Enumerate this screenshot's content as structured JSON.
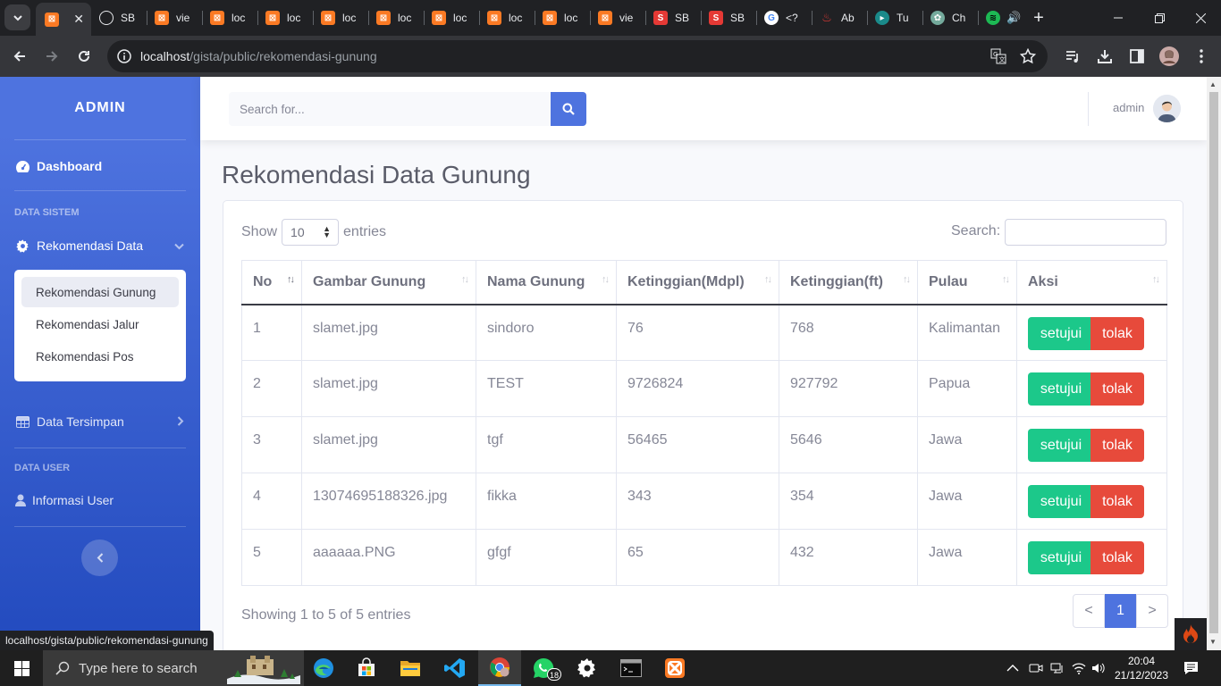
{
  "browser": {
    "tabs": [
      {
        "title": "",
        "icon": "xampp-icon",
        "color": "#fb7a24",
        "active": true
      },
      {
        "title": "SB",
        "icon": "globe-icon",
        "color": "#e8eaed"
      },
      {
        "title": "vie",
        "icon": "xampp-icon",
        "color": "#fb7a24"
      },
      {
        "title": "loc",
        "icon": "xampp-icon",
        "color": "#fb7a24"
      },
      {
        "title": "loc",
        "icon": "xampp-icon",
        "color": "#fb7a24"
      },
      {
        "title": "loc",
        "icon": "xampp-icon",
        "color": "#fb7a24"
      },
      {
        "title": "loc",
        "icon": "xampp-icon",
        "color": "#fb7a24"
      },
      {
        "title": "loc",
        "icon": "xampp-icon",
        "color": "#fb7a24"
      },
      {
        "title": "loc",
        "icon": "xampp-icon",
        "color": "#fb7a24"
      },
      {
        "title": "loc",
        "icon": "xampp-icon",
        "color": "#fb7a24"
      },
      {
        "title": "vie",
        "icon": "xampp-icon",
        "color": "#fb7a24"
      },
      {
        "title": "SB",
        "icon": "s-icon",
        "color": "#e53935"
      },
      {
        "title": "SB",
        "icon": "s-icon",
        "color": "#e53935"
      },
      {
        "title": "<?",
        "icon": "google-icon",
        "color": "#ffffff"
      },
      {
        "title": "Ab",
        "icon": "flame-icon",
        "color": "#e53935"
      },
      {
        "title": "Tu",
        "icon": "teal-icon",
        "color": "#1a8a8a"
      },
      {
        "title": "Ch",
        "icon": "chatgpt-icon",
        "color": "#74aa9c"
      },
      {
        "title": "",
        "icon": "spotify-icon",
        "color": "#1db954"
      }
    ],
    "url_host": "localhost",
    "url_path": "/gista/public/rekomendasi-gunung",
    "status_url": "localhost/gista/public/rekomendasi-gunung"
  },
  "sidebar": {
    "brand": "ADMIN",
    "dashboard": "Dashboard",
    "heading_sistem": "DATA SISTEM",
    "rekomendasi_data": "Rekomendasi Data",
    "sub_items": [
      "Rekomendasi Gunung",
      "Rekomendasi Jalur",
      "Rekomendasi Pos"
    ],
    "data_tersimpan": "Data Tersimpan",
    "heading_user": "DATA USER",
    "informasi_user": "Informasi User"
  },
  "topbar": {
    "search_placeholder": "Search for...",
    "user_name": "admin"
  },
  "main": {
    "title": "Rekomendasi Data Gunung",
    "show_label": "Show",
    "entries_label": "entries",
    "page_length": "10",
    "search_label": "Search:",
    "columns": [
      "No",
      "Gambar Gunung",
      "Nama Gunung",
      "Ketinggian(Mdpl)",
      "Ketinggian(ft)",
      "Pulau",
      "Aksi"
    ],
    "rows": [
      {
        "no": "1",
        "gambar": "slamet.jpg",
        "nama": "sindoro",
        "mdpl": "76",
        "ft": "768",
        "pulau": "Kalimantan"
      },
      {
        "no": "2",
        "gambar": "slamet.jpg",
        "nama": "TEST",
        "mdpl": "9726824",
        "ft": "927792",
        "pulau": "Papua"
      },
      {
        "no": "3",
        "gambar": "slamet.jpg",
        "nama": "tgf",
        "mdpl": "56465",
        "ft": "5646",
        "pulau": "Jawa"
      },
      {
        "no": "4",
        "gambar": "13074695188326.jpg",
        "nama": "fikka",
        "mdpl": "343",
        "ft": "354",
        "pulau": "Jawa"
      },
      {
        "no": "5",
        "gambar": "aaaaaa.PNG",
        "nama": "gfgf",
        "mdpl": "65",
        "ft": "432",
        "pulau": "Jawa"
      }
    ],
    "approve_label": "setujui",
    "reject_label": "tolak",
    "info": "Showing 1 to 5 of 5 entries",
    "pager": {
      "prev": "<",
      "current": "1",
      "next": ">"
    }
  },
  "taskbar": {
    "search_placeholder": "Type here to search",
    "whatsapp_badge": "18",
    "time": "20:04",
    "date": "21/12/2023"
  },
  "colors": {
    "primary": "#4e73df",
    "success": "#1cc88a",
    "danger": "#e74a3b"
  }
}
